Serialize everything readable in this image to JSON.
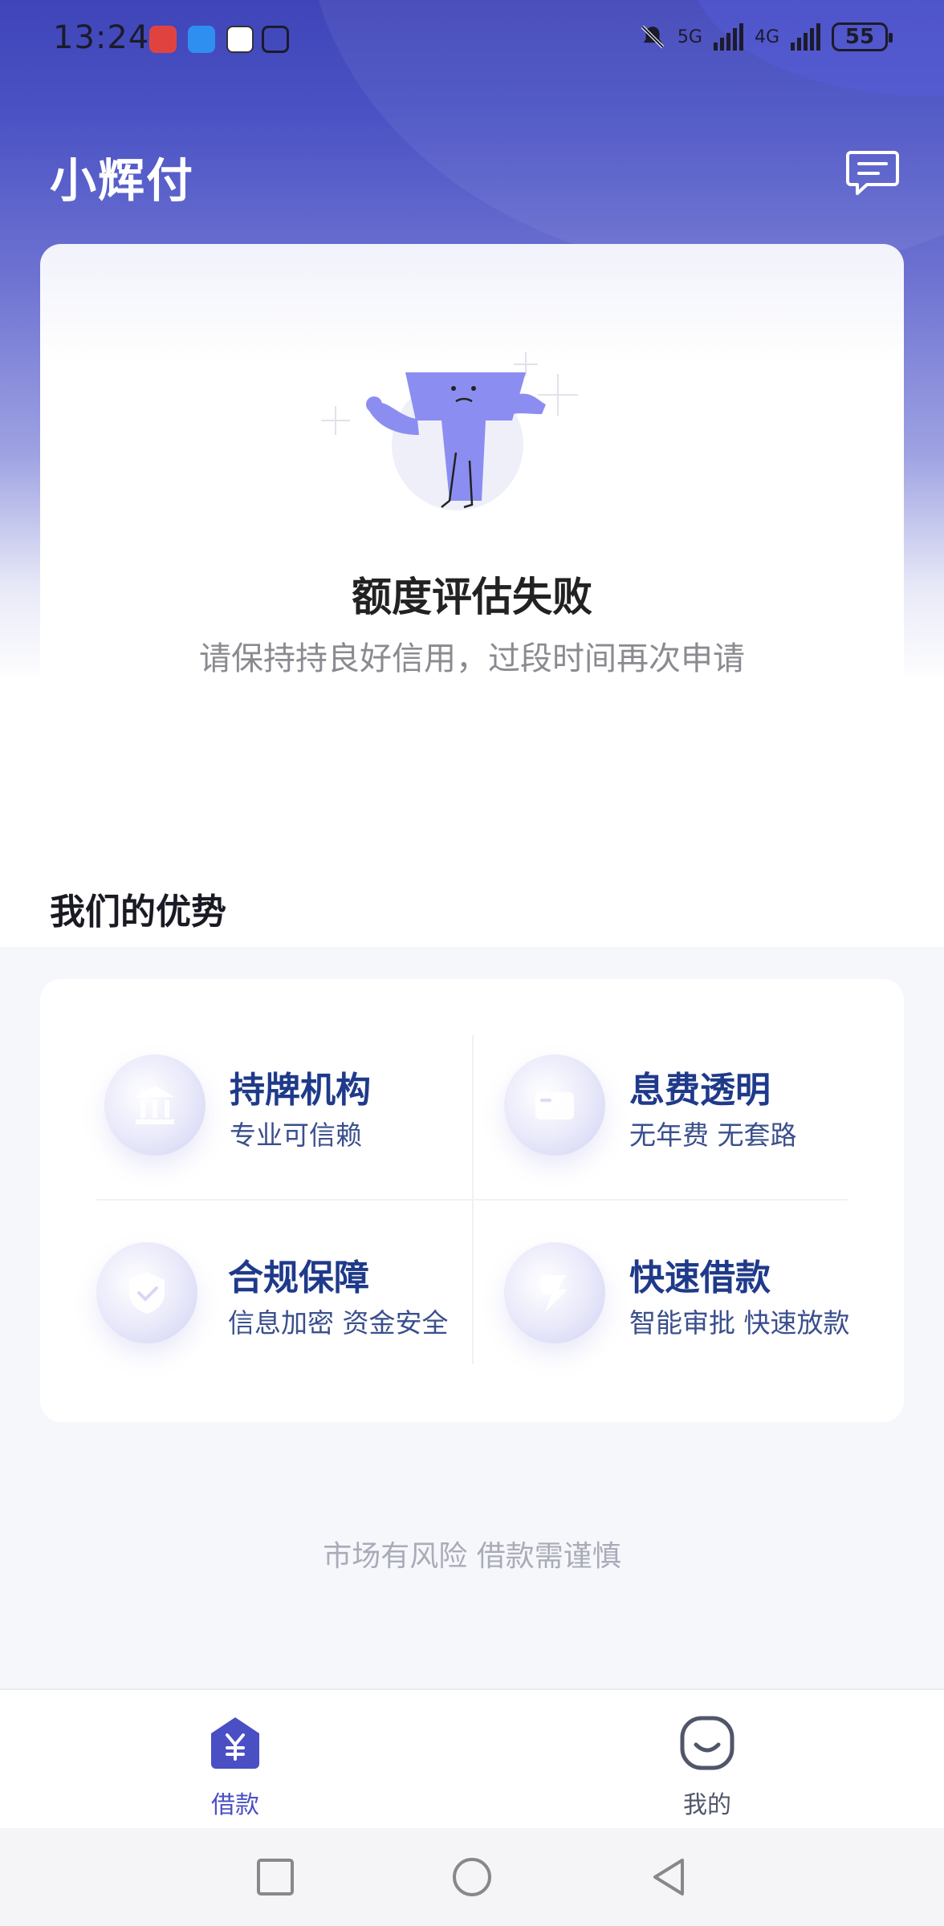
{
  "status_bar": {
    "time": "13:24",
    "net1": "5G",
    "net2": "4G",
    "battery": "55"
  },
  "header": {
    "title": "小辉付",
    "message_icon": "message-icon"
  },
  "result": {
    "title": "额度评估失败",
    "subtitle": "请保持持良好信用，过段时间再次申请"
  },
  "advantages": {
    "section_title": "我们的优势",
    "items": [
      {
        "title": "持牌机构",
        "desc": "专业可信赖",
        "icon": "bank-icon"
      },
      {
        "title": "息费透明",
        "desc": "无年费 无套路",
        "icon": "wallet-icon"
      },
      {
        "title": "合规保障",
        "desc": "信息加密 资金安全",
        "icon": "shield-icon"
      },
      {
        "title": "快速借款",
        "desc": "智能审批 快速放款",
        "icon": "lightning-icon"
      }
    ]
  },
  "footer_note": "市场有风险 借款需谨慎",
  "bottom_nav": {
    "items": [
      {
        "label": "借款",
        "icon": "yuan-home-icon",
        "active": true
      },
      {
        "label": "我的",
        "icon": "smile-face-icon",
        "active": false
      }
    ]
  },
  "colors": {
    "brand": "#4a4fc4",
    "title_blue": "#1f3a8a"
  }
}
